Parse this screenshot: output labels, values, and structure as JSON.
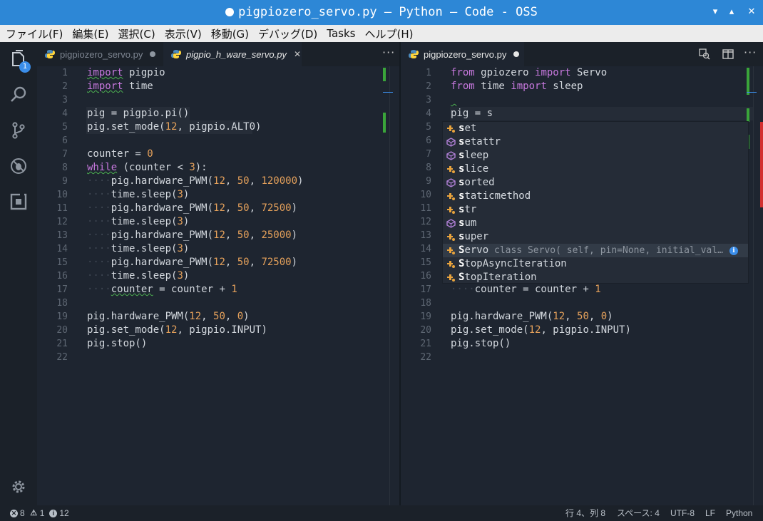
{
  "window": {
    "title": "pigpiozero_servo.py — Python — Code - OSS",
    "min_glyph": "▾",
    "max_glyph": "▴",
    "close_glyph": "✕"
  },
  "menu": [
    "ファイル(F)",
    "編集(E)",
    "選択(C)",
    "表示(V)",
    "移動(G)",
    "デバッグ(D)",
    "Tasks",
    "ヘルプ(H)"
  ],
  "activity": {
    "explorer_badge": "1",
    "items": [
      "files-icon",
      "search-icon",
      "source-control-icon",
      "debug-icon",
      "extensions-icon",
      "settings-gear-icon"
    ]
  },
  "left_group": {
    "tabs": [
      {
        "label": "pigpiozero_servo.py",
        "state": "inactive",
        "dirty": true
      },
      {
        "label": "pigpio_h_ware_servo.py",
        "state": "active",
        "close": "✕"
      }
    ],
    "more": "···",
    "lines": [
      {
        "n": "1",
        "html": "<span class=\"kw squig\">import</span> pigpio"
      },
      {
        "n": "2",
        "html": "<span class=\"kw squig\">import</span> time"
      },
      {
        "n": "3",
        "html": ""
      },
      {
        "n": "4",
        "html": "pig = pigpio.pi()",
        "hl": 145
      },
      {
        "n": "5",
        "html": "pig.set_mode(<span class=\"num\">12</span>, pigpio.ALT0)",
        "hl": 233
      },
      {
        "n": "6",
        "html": ""
      },
      {
        "n": "7",
        "html": "counter = <span class=\"num\">0</span>"
      },
      {
        "n": "8",
        "html": "<span class=\"kw squig\">while</span> (counter &lt; <span class=\"num\">3</span>):"
      },
      {
        "n": "9",
        "html": "<span class=\"ws\">····</span>pig.hardware_PWM(<span class=\"num\">12</span>, <span class=\"num\">50</span>, <span class=\"num\">120000</span>)"
      },
      {
        "n": "10",
        "html": "<span class=\"ws\">····</span>time.sleep(<span class=\"num\">3</span>)"
      },
      {
        "n": "11",
        "html": "<span class=\"ws\">····</span>pig.hardware_PWM(<span class=\"num\">12</span>, <span class=\"num\">50</span>, <span class=\"num\">72500</span>)"
      },
      {
        "n": "12",
        "html": "<span class=\"ws\">····</span>time.sleep(<span class=\"num\">3</span>)"
      },
      {
        "n": "13",
        "html": "<span class=\"ws\">····</span>pig.hardware_PWM(<span class=\"num\">12</span>, <span class=\"num\">50</span>, <span class=\"num\">25000</span>)"
      },
      {
        "n": "14",
        "html": "<span class=\"ws\">····</span>time.sleep(<span class=\"num\">3</span>)"
      },
      {
        "n": "15",
        "html": "<span class=\"ws\">····</span>pig.hardware_PWM(<span class=\"num\">12</span>, <span class=\"num\">50</span>, <span class=\"num\">72500</span>)"
      },
      {
        "n": "16",
        "html": "<span class=\"ws\">····</span>time.sleep(<span class=\"num\">3</span>)"
      },
      {
        "n": "17",
        "html": "<span class=\"ws\">····</span><span class=\"squig\">counter</span> = counter + <span class=\"num\">1</span>"
      },
      {
        "n": "18",
        "html": ""
      },
      {
        "n": "19",
        "html": "pig.hardware_PWM(<span class=\"num\">12</span>, <span class=\"num\">50</span>, <span class=\"num\">0</span>)"
      },
      {
        "n": "20",
        "html": "pig.set_mode(<span class=\"num\">12</span>, pigpio.INPUT)"
      },
      {
        "n": "21",
        "html": "pig.stop()"
      },
      {
        "n": "22",
        "html": ""
      }
    ]
  },
  "right_group": {
    "tabs": [
      {
        "label": "pigpiozero_servo.py",
        "state": "active",
        "dirty": true
      }
    ],
    "toolbar": [
      "open-preview-icon",
      "split-editor-icon",
      "more-actions-icon"
    ],
    "more": "···",
    "lines": [
      {
        "n": "1",
        "html": "<span class=\"kw\">from</span> gpiozero <span class=\"kw\">import</span> Servo"
      },
      {
        "n": "2",
        "html": "<span class=\"kw\">from</span> time <span class=\"kw\">import</span> sleep"
      },
      {
        "n": "3",
        "html": "<span class=\"squig\"> </span>"
      },
      {
        "n": "4",
        "html": "pig = s",
        "cur": true
      },
      {
        "n": "5",
        "html": ""
      },
      {
        "n": "6",
        "html": ""
      },
      {
        "n": "7",
        "html": ""
      },
      {
        "n": "8",
        "html": ""
      },
      {
        "n": "9",
        "html": ""
      },
      {
        "n": "10",
        "html": ""
      },
      {
        "n": "11",
        "html": ""
      },
      {
        "n": "12",
        "html": ""
      },
      {
        "n": "13",
        "html": ""
      },
      {
        "n": "14",
        "html": ""
      },
      {
        "n": "15",
        "html": ""
      },
      {
        "n": "16",
        "html": ""
      },
      {
        "n": "17",
        "html": "<span class=\"ws\">····</span>counter = counter + <span class=\"num\">1</span>"
      },
      {
        "n": "18",
        "html": ""
      },
      {
        "n": "19",
        "html": "pig.hardware_PWM(<span class=\"num\">12</span>, <span class=\"num\">50</span>, <span class=\"num\">0</span>)"
      },
      {
        "n": "20",
        "html": "pig.set_mode(<span class=\"num\">12</span>, pigpio.INPUT)"
      },
      {
        "n": "21",
        "html": "pig.stop()"
      },
      {
        "n": "22",
        "html": ""
      }
    ],
    "suggestions": [
      {
        "label": "set",
        "kind": "class"
      },
      {
        "label": "setattr",
        "kind": "function"
      },
      {
        "label": "sleep",
        "kind": "function"
      },
      {
        "label": "slice",
        "kind": "class"
      },
      {
        "label": "sorted",
        "kind": "function"
      },
      {
        "label": "staticmethod",
        "kind": "class"
      },
      {
        "label": "str",
        "kind": "class"
      },
      {
        "label": "sum",
        "kind": "function"
      },
      {
        "label": "super",
        "kind": "class"
      },
      {
        "label": "Servo",
        "kind": "class",
        "selected": true,
        "detail": "class Servo( self, pin=None, initial_val…",
        "info": "i"
      },
      {
        "label": "StopAsyncIteration",
        "kind": "class"
      },
      {
        "label": "StopIteration",
        "kind": "class"
      }
    ]
  },
  "status": {
    "errors": "8",
    "warnings": "1",
    "infos": "12",
    "position": "行 4、列 8",
    "indent": "スペース: 4",
    "encoding": "UTF-8",
    "eol": "LF",
    "language": "Python"
  },
  "colors": {
    "titlebar": "#2d87d6",
    "keyword": "#c678dd",
    "number": "#e5a15b",
    "class_icon": "#e8a33d",
    "function_icon": "#b180d7",
    "git_added": "#3aa53a",
    "git_deleted": "#d32f2f"
  }
}
